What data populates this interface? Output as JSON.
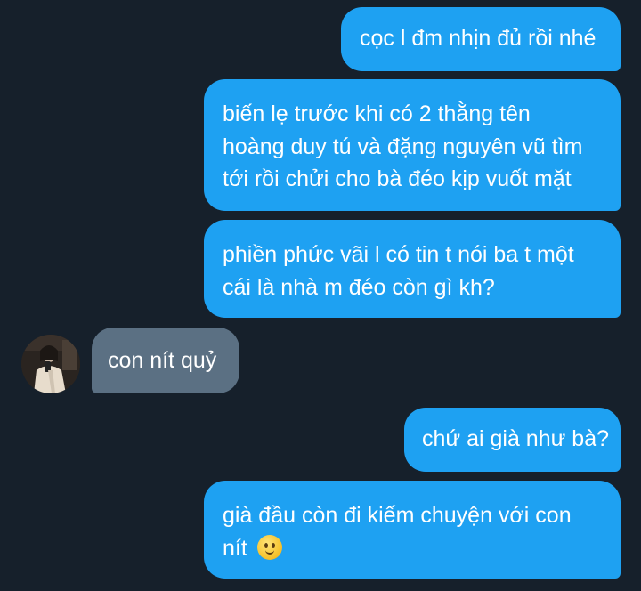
{
  "messages": [
    {
      "side": "sent",
      "lines": [
        "cọc l đm nhịn đủ rồi nhé"
      ]
    },
    {
      "side": "sent",
      "lines": [
        "biến lẹ trước khi có 2 thằng tên",
        "hoàng duy tú và đặng nguyên vũ tìm",
        "tới rồi chửi cho bà đéo kịp vuốt mặt"
      ]
    },
    {
      "side": "sent",
      "lines": [
        "phiền phức vãi l có tin t nói ba t một",
        "cái là nhà m đéo còn gì kh?"
      ]
    },
    {
      "side": "received",
      "lines": [
        "con nít quỷ"
      ]
    },
    {
      "side": "sent",
      "lines": [
        "chứ ai già như bà?"
      ]
    },
    {
      "side": "sent",
      "lines": [
        "già đầu còn đi kiếm chuyện với con",
        "nít"
      ],
      "trailing_icon": "slightly-smiling-face-emoji"
    }
  ],
  "colors": {
    "background": "#16202b",
    "sent_bubble": "#1ea1f2",
    "received_bubble": "#5b7083",
    "text": "#ffffff"
  },
  "icons": {
    "avatar": "contact-avatar",
    "emoji": "slightly-smiling-face-emoji"
  }
}
